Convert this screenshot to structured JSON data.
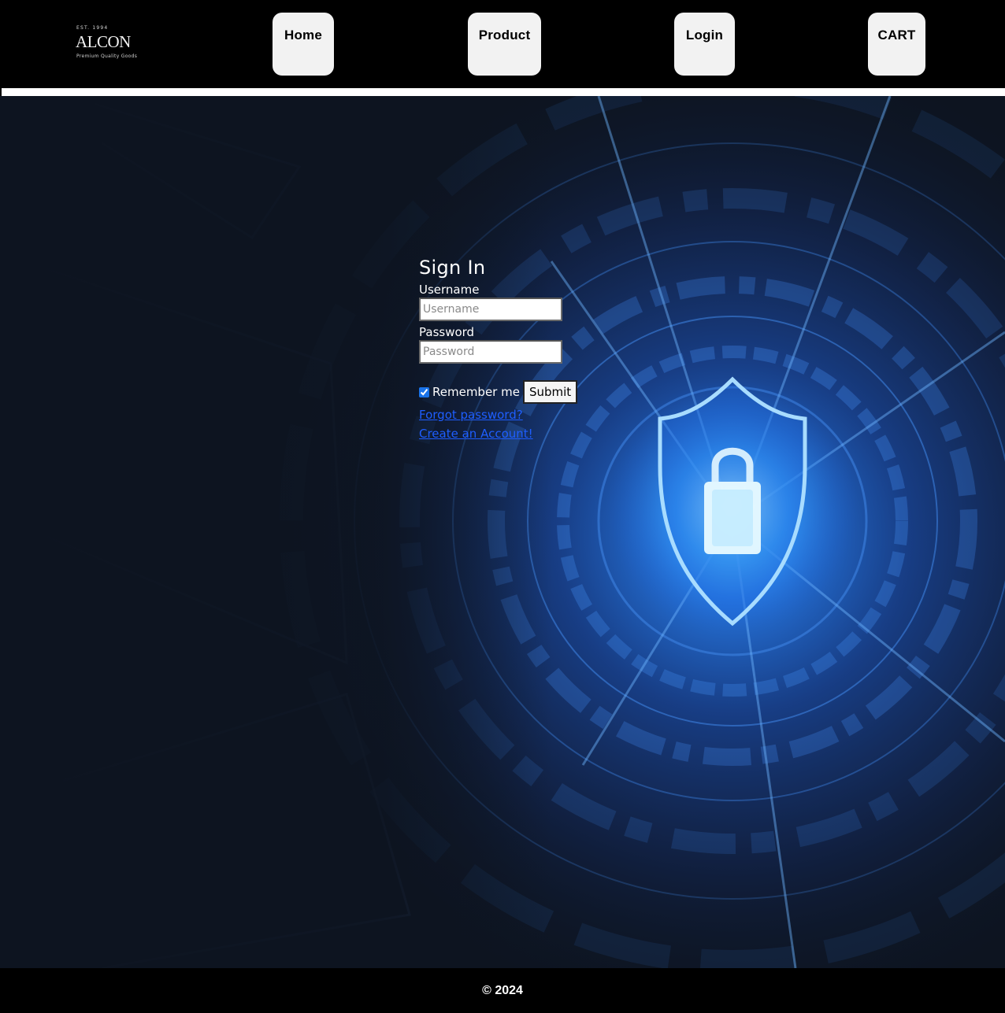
{
  "logo": {
    "est": "EST. 1994",
    "brand": "ALCON",
    "tagline": "Premium Quality Goods"
  },
  "nav": {
    "home": "Home",
    "product": "Product",
    "login": "Login",
    "cart": "CART"
  },
  "signin": {
    "title": "Sign In",
    "username_label": "Username",
    "username_placeholder": "Username",
    "password_label": "Password",
    "password_placeholder": "Password",
    "remember_label": "Remember me",
    "remember_checked": true,
    "submit_label": "Submit",
    "forgot_link": "Forgot password?",
    "create_link": "Create an Account!"
  },
  "footer": {
    "copyright": "© 2024"
  },
  "colors": {
    "header_bg": "#000000",
    "nav_button_bg": "#f2f2f2",
    "hero_dark": "#0d1420",
    "hero_glow": "#2f8cff",
    "link": "#1e5eff"
  },
  "icons": {
    "hero": "shield-lock-icon"
  }
}
